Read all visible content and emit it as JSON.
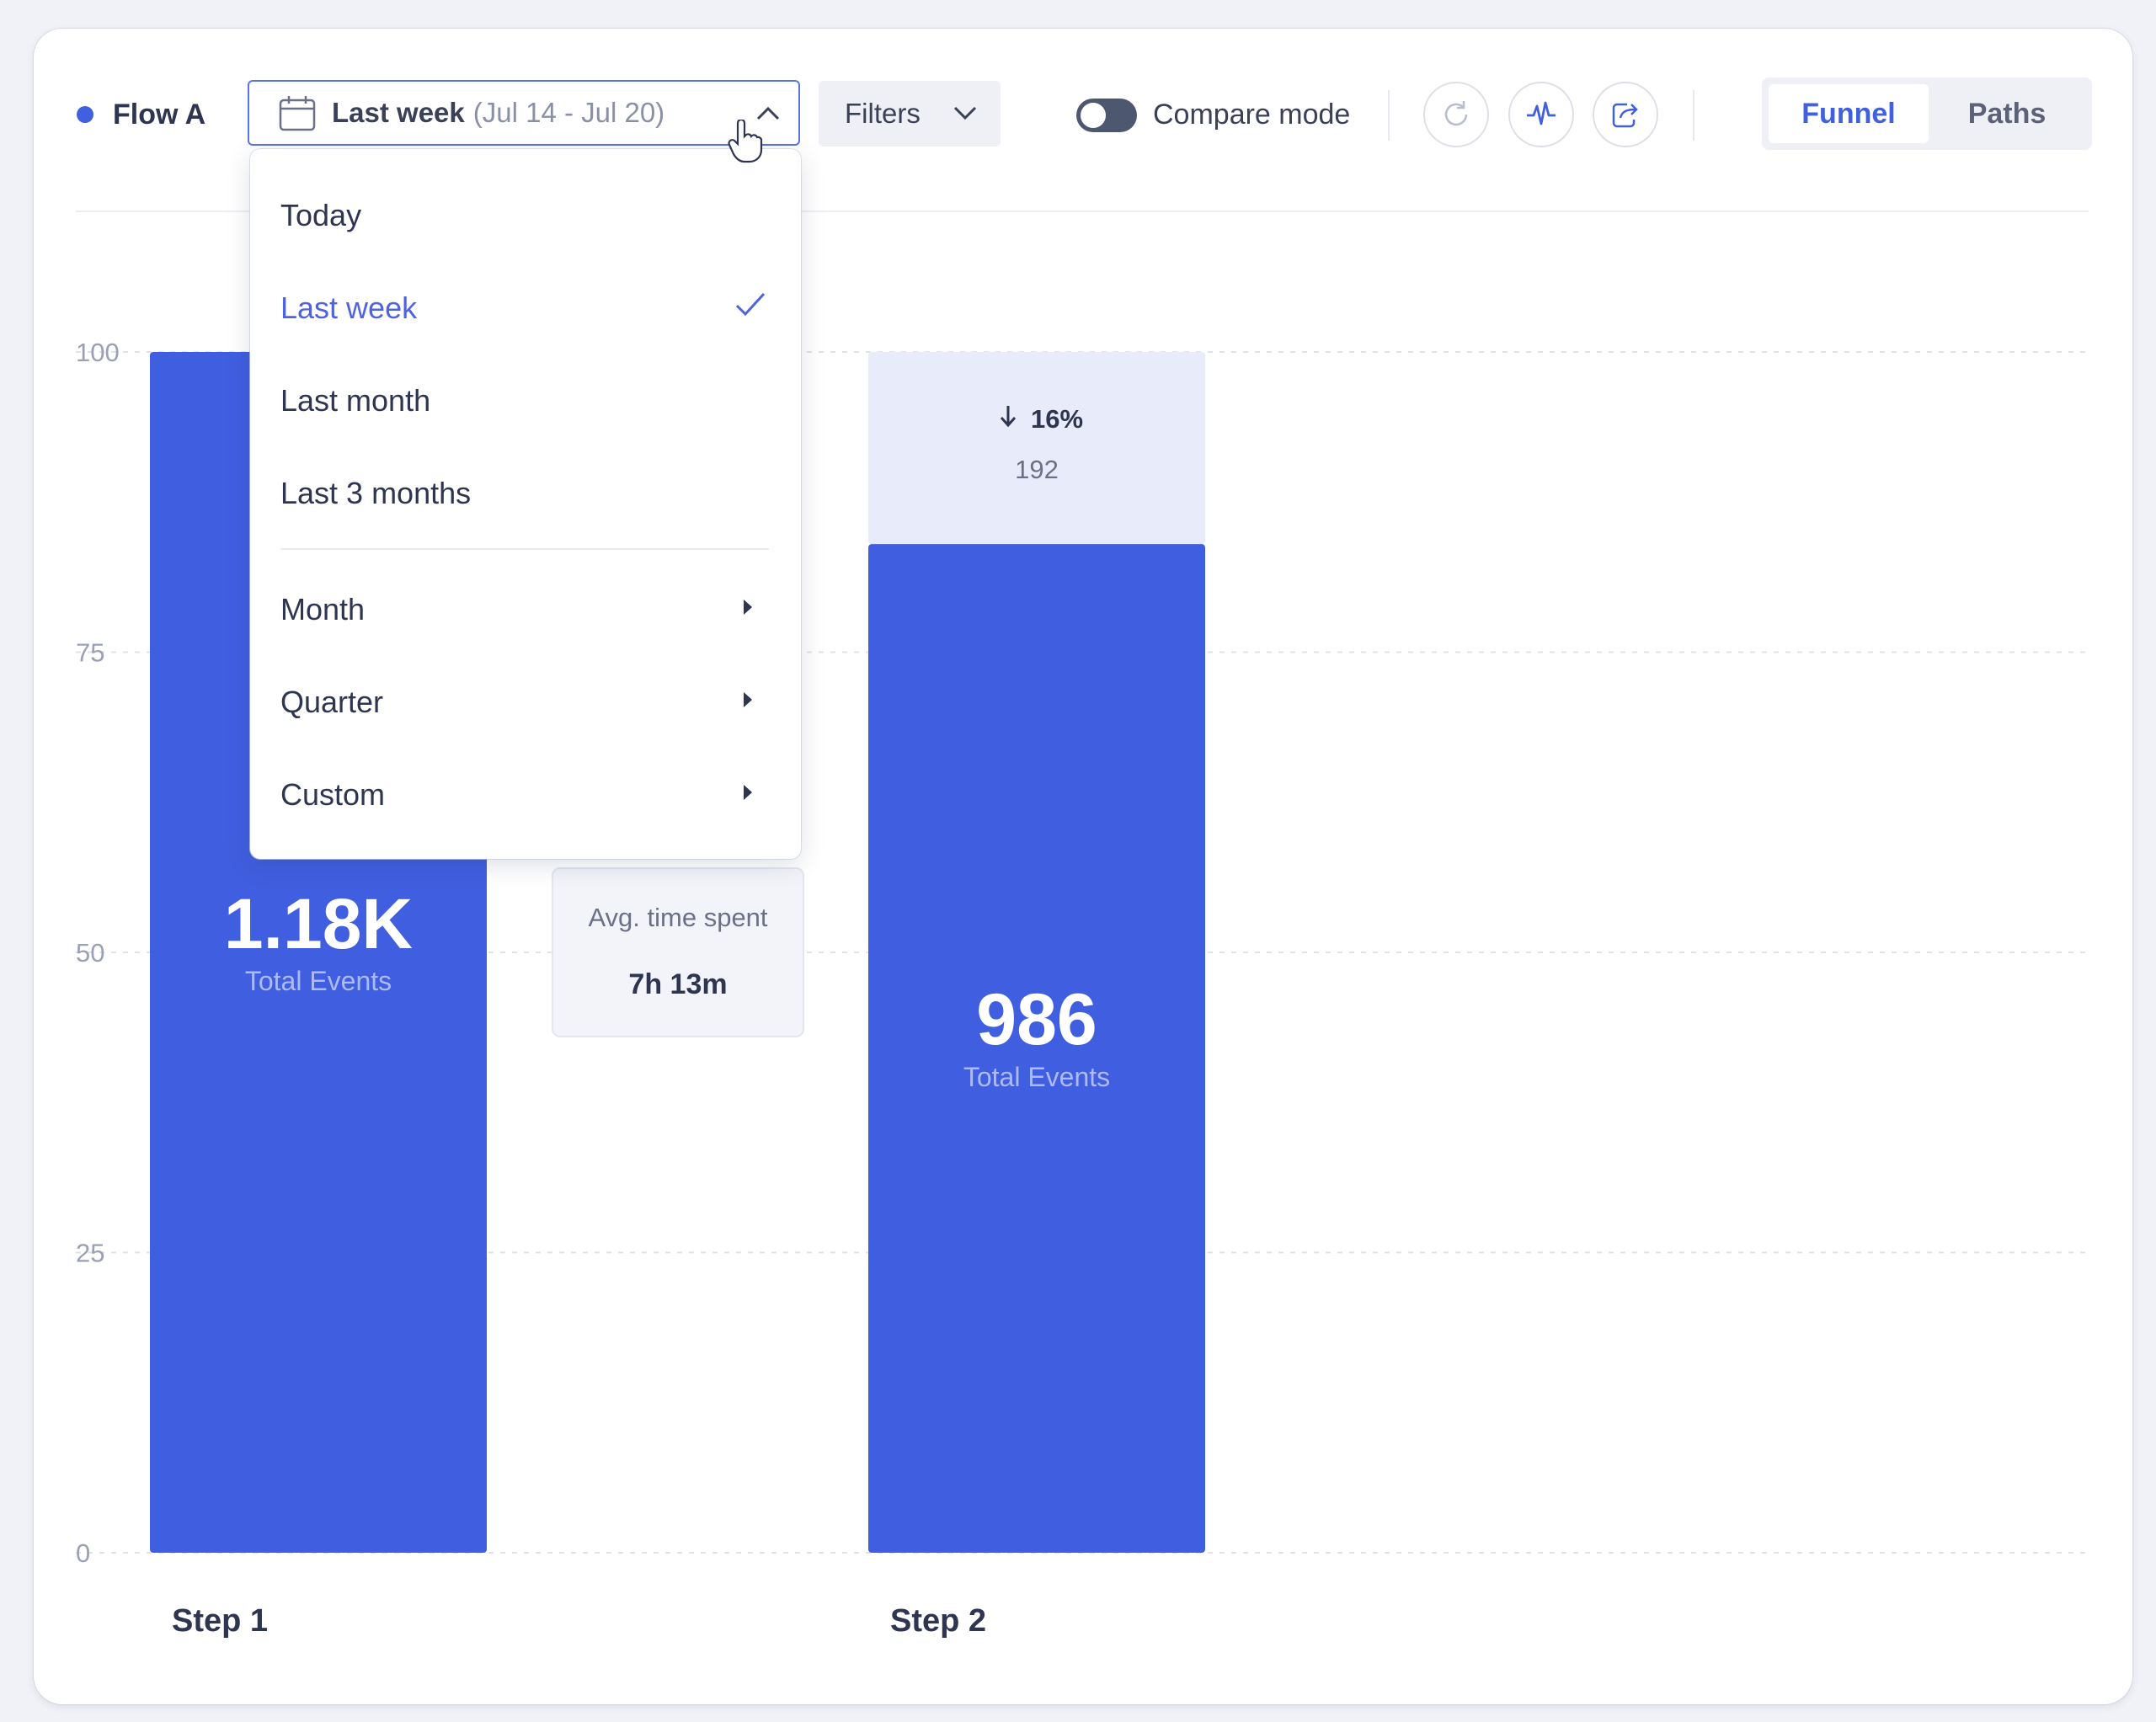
{
  "toolbar": {
    "flow_label": "Flow A",
    "date_range": {
      "selected_label": "Last week",
      "range_text": "(Jul 14 - Jul 20)",
      "open": true
    },
    "filters_label": "Filters",
    "compare_mode": {
      "label": "Compare mode",
      "enabled": false
    },
    "icons": [
      "refresh-icon",
      "activity-icon",
      "share-icon"
    ],
    "view_tabs": [
      {
        "label": "Funnel",
        "active": true
      },
      {
        "label": "Paths",
        "active": false
      }
    ]
  },
  "date_menu": {
    "items": [
      {
        "label": "Today",
        "selected": false
      },
      {
        "label": "Last week",
        "selected": true
      },
      {
        "label": "Last month",
        "selected": false
      },
      {
        "label": "Last 3 months",
        "selected": false
      }
    ],
    "submenus": [
      {
        "label": "Month"
      },
      {
        "label": "Quarter"
      },
      {
        "label": "Custom"
      }
    ]
  },
  "chart_data": {
    "type": "bar",
    "categories": [
      "Step 1",
      "Step 2"
    ],
    "values": [
      100,
      84
    ],
    "ylim": [
      0,
      100
    ],
    "yticks": [
      0,
      25,
      50,
      75,
      100
    ],
    "grid": true,
    "colors": {
      "bar": "#405fe0",
      "drop": "#e8ebfa"
    },
    "bars": [
      {
        "category": "Step 1",
        "total_label": "1.18K",
        "total_caption": "Total Events"
      },
      {
        "category": "Step 2",
        "total_label": "986",
        "total_caption": "Total Events",
        "dropoff": {
          "percent_label": "16%",
          "count_label": "192"
        }
      }
    ],
    "avg_time": {
      "label": "Avg. time spent",
      "value": "7h 13m"
    }
  }
}
